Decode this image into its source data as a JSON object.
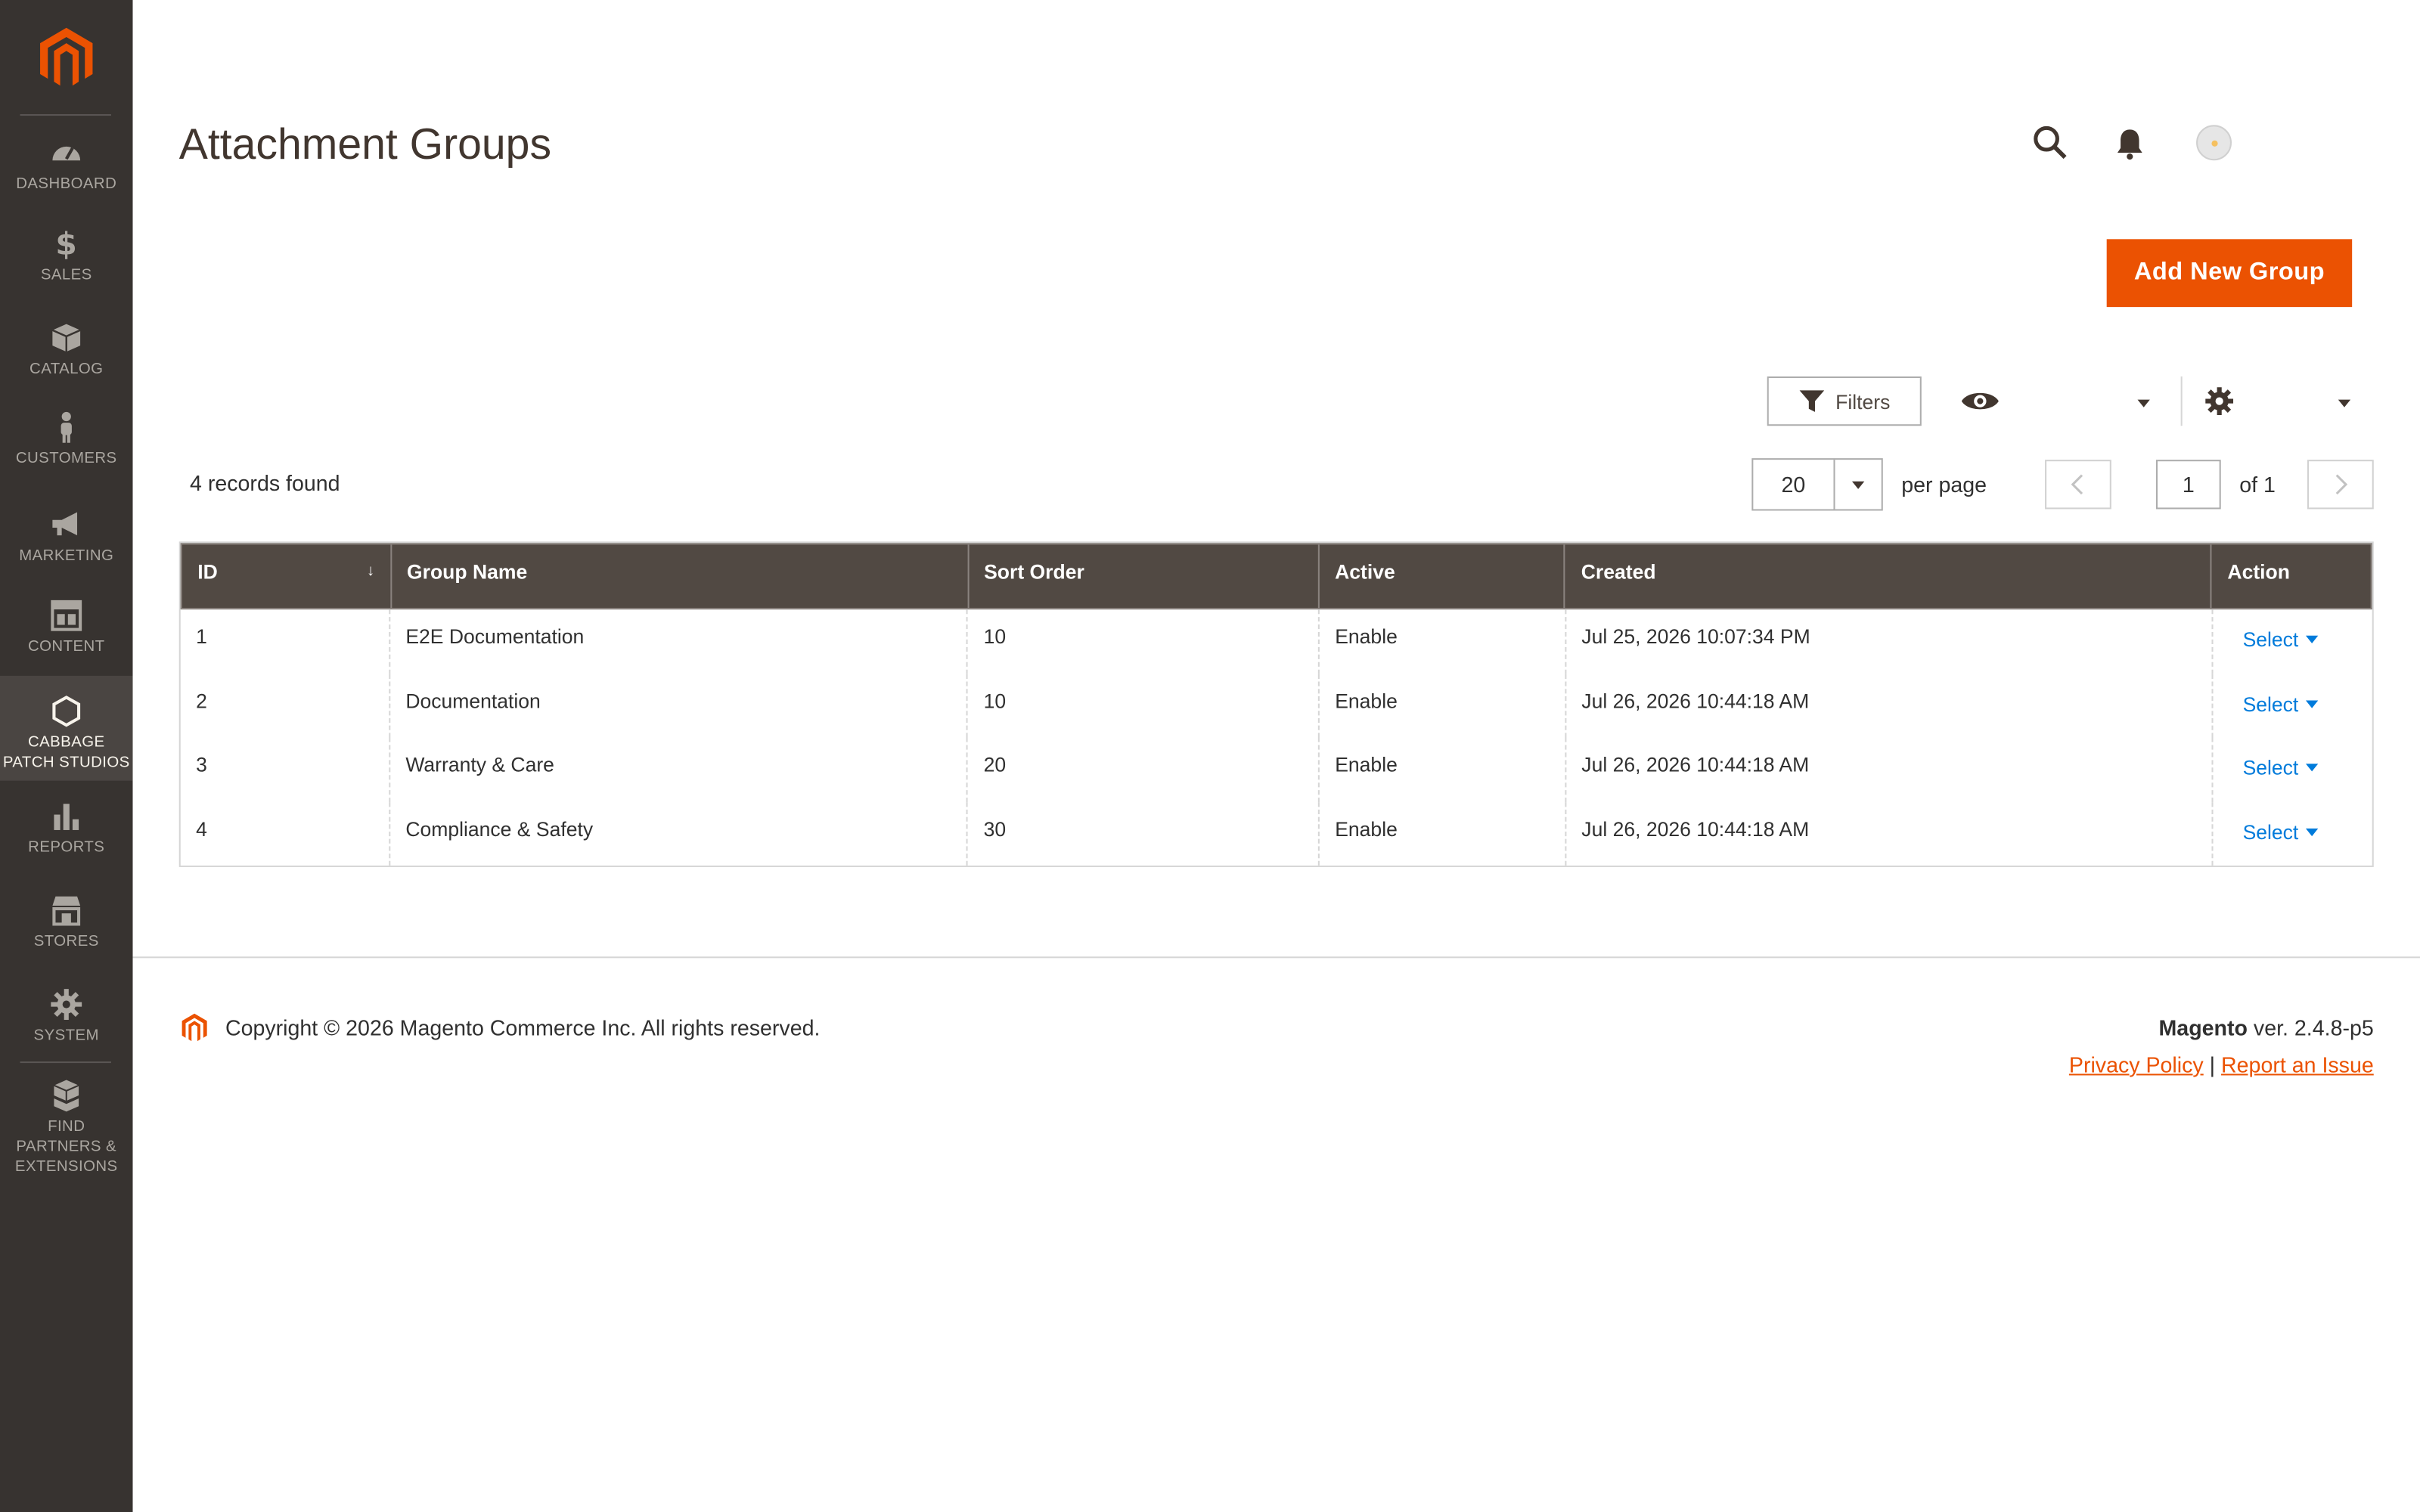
{
  "sidebar": {
    "logo": "magento-logo",
    "items": [
      {
        "label": "DASHBOARD",
        "icon": "dashboard-icon"
      },
      {
        "label": "SALES",
        "icon": "dollar-icon"
      },
      {
        "label": "CATALOG",
        "icon": "box-icon"
      },
      {
        "label": "CUSTOMERS",
        "icon": "person-icon"
      },
      {
        "label": "MARKETING",
        "icon": "megaphone-icon"
      },
      {
        "label": "CONTENT",
        "icon": "layout-icon"
      },
      {
        "label": "CABBAGE PATCH STUDIOS",
        "icon": "hexagon-icon"
      },
      {
        "label": "REPORTS",
        "icon": "bar-chart-icon"
      },
      {
        "label": "STORES",
        "icon": "storefront-icon"
      },
      {
        "label": "SYSTEM",
        "icon": "gear-icon"
      },
      {
        "label": "FIND PARTNERS & EXTENSIONS",
        "icon": "cubes-icon"
      }
    ]
  },
  "header": {
    "title": "Attachment Groups",
    "add_button": "Add New Group"
  },
  "toolbar": {
    "filters_label": "Filters",
    "records_found": "4 records found",
    "per_page_value": "20",
    "per_page_label": "per page",
    "page_value": "1",
    "page_of": "of 1"
  },
  "grid": {
    "columns": [
      "ID",
      "Group Name",
      "Sort Order",
      "Active",
      "Created",
      "Action"
    ],
    "sort_indicator": "↓",
    "rows": [
      {
        "id": "1",
        "name": "E2E Documentation",
        "sort": "10",
        "active": "Enable",
        "created": "Jul 25, 2026 10:07:34 PM",
        "action": "Select"
      },
      {
        "id": "2",
        "name": "Documentation",
        "sort": "10",
        "active": "Enable",
        "created": "Jul 26, 2026 10:44:18 AM",
        "action": "Select"
      },
      {
        "id": "3",
        "name": "Warranty & Care",
        "sort": "20",
        "active": "Enable",
        "created": "Jul 26, 2026 10:44:18 AM",
        "action": "Select"
      },
      {
        "id": "4",
        "name": "Compliance & Safety",
        "sort": "30",
        "active": "Enable",
        "created": "Jul 26, 2026 10:44:18 AM",
        "action": "Select"
      }
    ]
  },
  "footer": {
    "copyright": "Copyright © 2026 Magento Commerce Inc. All rights reserved.",
    "brand": "Magento",
    "version": "ver. 2.4.8-p5",
    "privacy": "Privacy Policy",
    "separator": "|",
    "report": "Report an Issue"
  },
  "colors": {
    "accent": "#eb5202",
    "sidebar_bg": "#373330",
    "grid_header": "#514943",
    "link": "#007bdb"
  }
}
